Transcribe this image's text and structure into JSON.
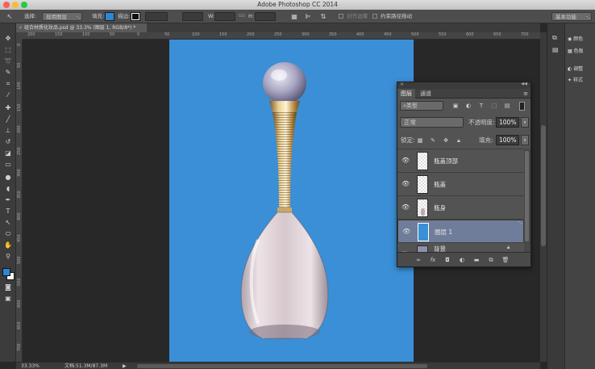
{
  "window": {
    "title": "Adobe Photoshop CC 2014"
  },
  "options_bar": {
    "tool_select_label": "选择:",
    "layer_select_value": "现用图层",
    "fill_label": "填充:",
    "stroke_label": "描边:",
    "w_label": "W:",
    "link_label": "GO",
    "h_label": "H:",
    "align_edges_label": "对齐边缘",
    "constrain_label": "约束路径拖动",
    "workspace_value": "基本功能"
  },
  "document": {
    "tab_title": "组合材质化妆品.psd @ 33.3% (图层 1, RGB/8*) *",
    "zoom": "33.33%",
    "doc_size": "文档:51.3M/87.3M"
  },
  "ruler": {
    "h_labels": [
      "200",
      "150",
      "100",
      "50",
      "0",
      "50",
      "100",
      "150",
      "200",
      "250",
      "300",
      "350",
      "400",
      "450",
      "500",
      "550",
      "600",
      "650",
      "700"
    ],
    "v_labels": [
      "0",
      "50",
      "100",
      "150",
      "200",
      "250",
      "300",
      "350",
      "400",
      "450",
      "500",
      "550",
      "600",
      "650",
      "700"
    ]
  },
  "dock": {
    "items": [
      {
        "label": "颜色",
        "icon": "color-wheel-icon"
      },
      {
        "label": "色板",
        "icon": "swatches-icon"
      },
      {
        "label": "调整",
        "icon": "adjustments-icon"
      },
      {
        "label": "样式",
        "icon": "styles-icon"
      }
    ]
  },
  "layers_panel": {
    "tabs": [
      "图层",
      "通道"
    ],
    "filter_kind": "类型",
    "blend_mode": "正常",
    "opacity_label": "不透明度:",
    "opacity_value": "100%",
    "lock_label": "锁定:",
    "fill_label": "填充:",
    "fill_value": "100%",
    "layers": [
      {
        "name": "瓶盖顶部",
        "visible": true,
        "selected": false
      },
      {
        "name": "瓶盖",
        "visible": true,
        "selected": false
      },
      {
        "name": "瓶身",
        "visible": true,
        "selected": false
      },
      {
        "name": "图层 1",
        "visible": true,
        "selected": true
      },
      {
        "name": "背景",
        "visible": false,
        "selected": false
      }
    ],
    "footer_fx": "fx"
  },
  "colors": {
    "canvas_blue": "#3b8fd6",
    "selected_layer": "#6f7d9a",
    "foreground_swatch": "#2f86d1"
  }
}
